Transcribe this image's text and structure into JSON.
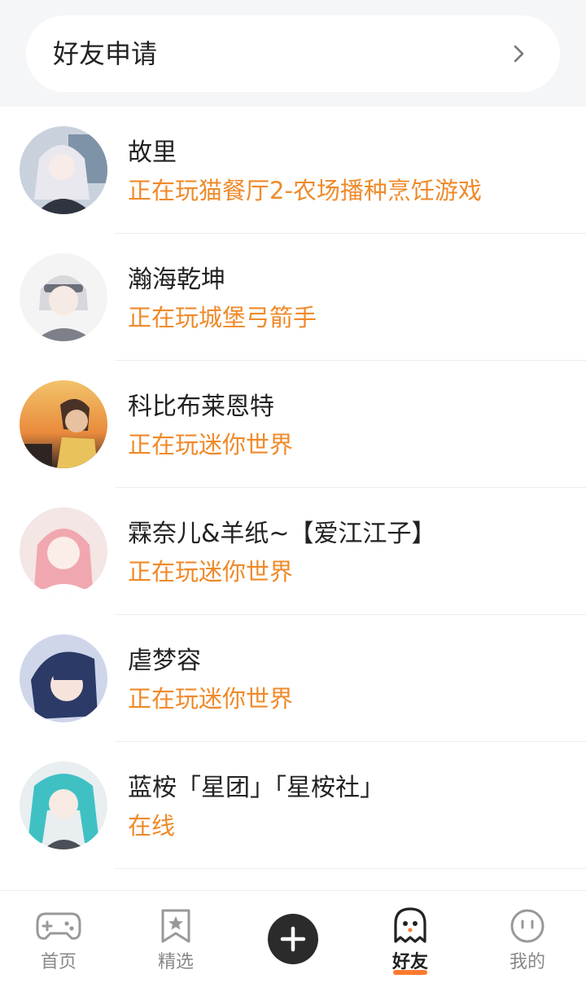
{
  "friend_requests": {
    "label": "好友申请"
  },
  "friends": [
    {
      "name": "故里",
      "status": "正在玩猫餐厅2-农场播种烹饪游戏"
    },
    {
      "name": "瀚海乾坤",
      "status": "正在玩城堡弓箭手"
    },
    {
      "name": "科比布莱恩特",
      "status": "正在玩迷你世界"
    },
    {
      "name": "霖奈儿&羊纸~【爱江江子】",
      "status": "正在玩迷你世界"
    },
    {
      "name": "虐梦容",
      "status": "正在玩迷你世界"
    },
    {
      "name": "蓝桉「星团」「星桉社」",
      "status": "在线"
    }
  ],
  "tabs": [
    {
      "label": "首页",
      "icon": "gamepad-icon"
    },
    {
      "label": "精选",
      "icon": "star-bookmark-icon"
    },
    {
      "label": "",
      "icon": "plus-icon"
    },
    {
      "label": "好友",
      "icon": "ghost-icon",
      "active": true
    },
    {
      "label": "我的",
      "icon": "face-icon"
    }
  ],
  "colors": {
    "accent": "#ef8a2a",
    "tab_indicator": "#ff7a2f",
    "background": "#f5f6f8"
  }
}
